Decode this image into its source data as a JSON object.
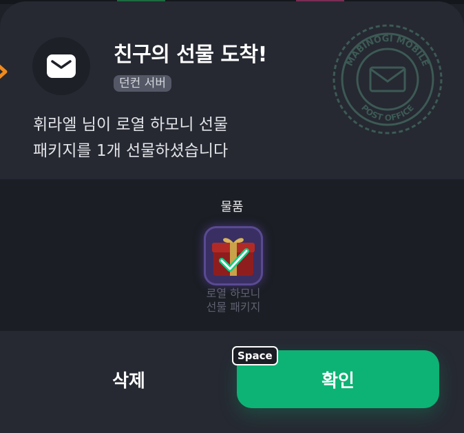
{
  "dialog": {
    "title": "친구의 선물 도착!",
    "server_badge": "던컨 서버",
    "message_line1": "휘라엘 님이 로열 하모니 선물",
    "message_line2": "패키지를 1개 선물하셨습니다",
    "envelope_icon": "envelope-icon",
    "stamp_icon": "post-office-stamp",
    "stamp_text_top": "MABINOGI MOBILE",
    "stamp_text_bottom": "POST OFFICE"
  },
  "items": {
    "label": "물품",
    "list": [
      {
        "name_line1": "로열 하모니",
        "name_line2": "선물 패키지",
        "icon": "gift-box-icon",
        "checked": true
      }
    ]
  },
  "actions": {
    "delete_label": "삭제",
    "confirm_label": "확인",
    "confirm_key_hint": "Space"
  },
  "colors": {
    "accent": "#0db374",
    "panel_bg": "#262932",
    "item_frame": "#3a2f63"
  }
}
